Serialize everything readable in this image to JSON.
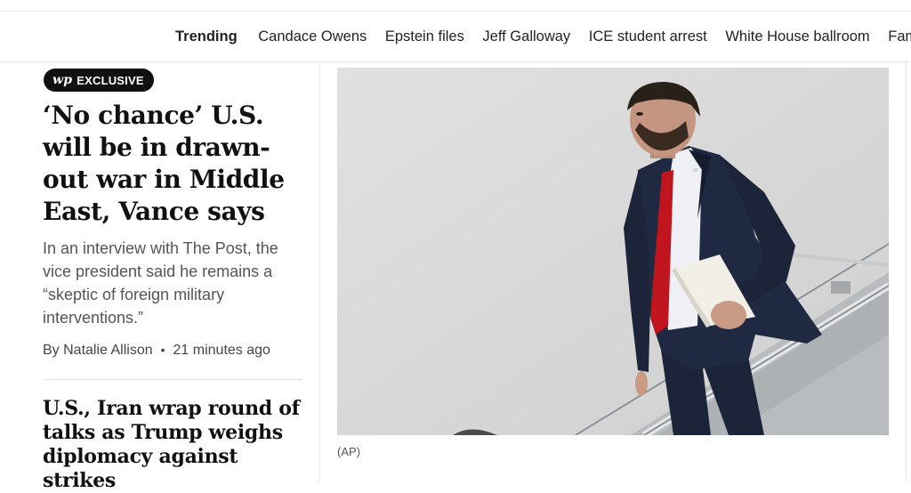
{
  "trending": {
    "label": "Trending",
    "items": [
      "Candace Owens",
      "Epstein files",
      "Jeff Galloway",
      "ICE student arrest",
      "White House ballroom",
      "Family"
    ]
  },
  "lead_story": {
    "badge_logo": "wp",
    "badge_text": "EXCLUSIVE",
    "headline": "‘No chance’ U.S. will be in drawn-out war in Middle East, Vance says",
    "dek": "In an interview with The Post, the vice president said he remains a “skeptic of foreign military interventions.”",
    "byline_author": "By Natalie Allison",
    "byline_time": "21 minutes ago",
    "photo_credit": "(AP)"
  },
  "second_story": {
    "headline": "U.S., Iran wrap round of talks as Trump weighs diplomacy against strikes"
  },
  "colors": {
    "badge_bg": "#111111",
    "photo_sky": "#dcdcdc",
    "suit": "#1b2438",
    "tie": "#c0141f"
  }
}
